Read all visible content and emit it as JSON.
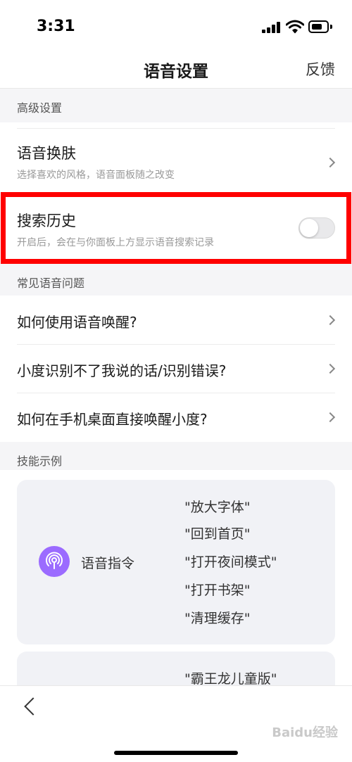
{
  "status_bar": {
    "time": "3:31"
  },
  "nav": {
    "title": "语音设置",
    "feedback": "反馈"
  },
  "sections": {
    "advanced": "高级设置",
    "faq": "常见语音问题",
    "skills": "技能示例"
  },
  "advanced": {
    "skin": {
      "title": "语音换肤",
      "subtitle": "选择喜欢的风格，语音面板随之改变"
    },
    "history": {
      "title": "搜索历史",
      "subtitle": "开启后，会在与你面板上方显示语音搜索记录",
      "enabled": false
    }
  },
  "faq": {
    "items": [
      "如何使用语音唤醒?",
      "小度识别不了我说的话/识别错误?",
      "如何在手机桌面直接唤醒小度?"
    ]
  },
  "skills": {
    "card1": {
      "icon": "voice-command-icon",
      "name": "语音指令",
      "commands": [
        "\"放大字体\"",
        "\"回到首页\"",
        "\"打开夜间模式\"",
        "\"打开书架\"",
        "\"清理缓存\""
      ]
    },
    "card2": {
      "commands": [
        "\"霸王龙儿童版\""
      ]
    }
  },
  "watermark": "Baidu经验",
  "colors": {
    "highlight": "#ff0000",
    "skill_icon": "#9b6bff",
    "card_bg": "#f1f2f6"
  }
}
